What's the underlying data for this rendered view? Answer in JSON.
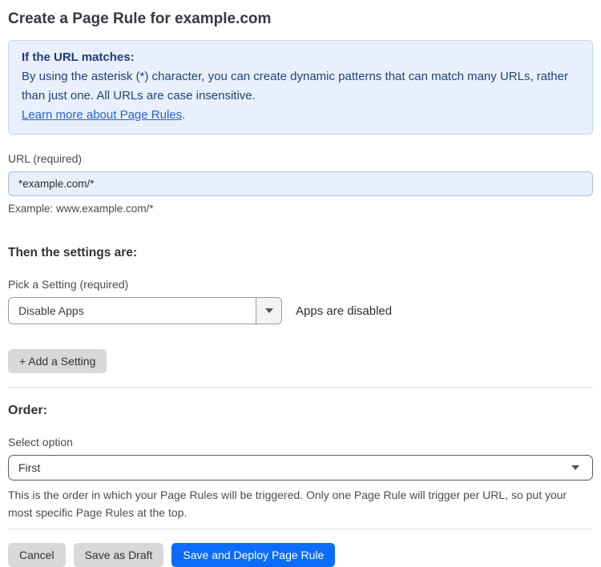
{
  "page": {
    "title": "Create a Page Rule for example.com"
  },
  "info_box": {
    "heading": "If the URL matches:",
    "body": "By using the asterisk (*) character, you can create dynamic patterns that can match many URLs, rather than just one. All URLs are case insensitive.",
    "link_label": "Learn more about Page Rules",
    "link_suffix": "."
  },
  "url_field": {
    "label": "URL (required)",
    "value": "*example.com/*",
    "helper": "Example: www.example.com/*"
  },
  "settings_section": {
    "heading": "Then the settings are:",
    "setting_label": "Pick a Setting (required)",
    "setting_value": "Disable Apps",
    "setting_status": "Apps are disabled",
    "add_setting_label": "+ Add a Setting"
  },
  "order_section": {
    "heading": "Order:",
    "select_label": "Select option",
    "select_value": "First",
    "helper": "This is the order in which your Page Rules will be triggered. Only one Page Rule will trigger per URL, so put your most specific Page Rules at the top."
  },
  "footer": {
    "cancel_label": "Cancel",
    "save_draft_label": "Save as Draft",
    "save_deploy_label": "Save and Deploy Page Rule"
  },
  "icons": {
    "setting_select_caret": "caret-down",
    "order_select_caret": "caret-down"
  },
  "colors": {
    "accent_blue": "#0b6cfb",
    "info_box_bg": "#e8f1fb",
    "info_box_border": "#bdd8f1",
    "info_text_navy": "#23417c",
    "link_blue": "#2a5fdb",
    "url_input_bg": "#e9f0fb",
    "neutral_button_bg": "#d8d8d8"
  }
}
